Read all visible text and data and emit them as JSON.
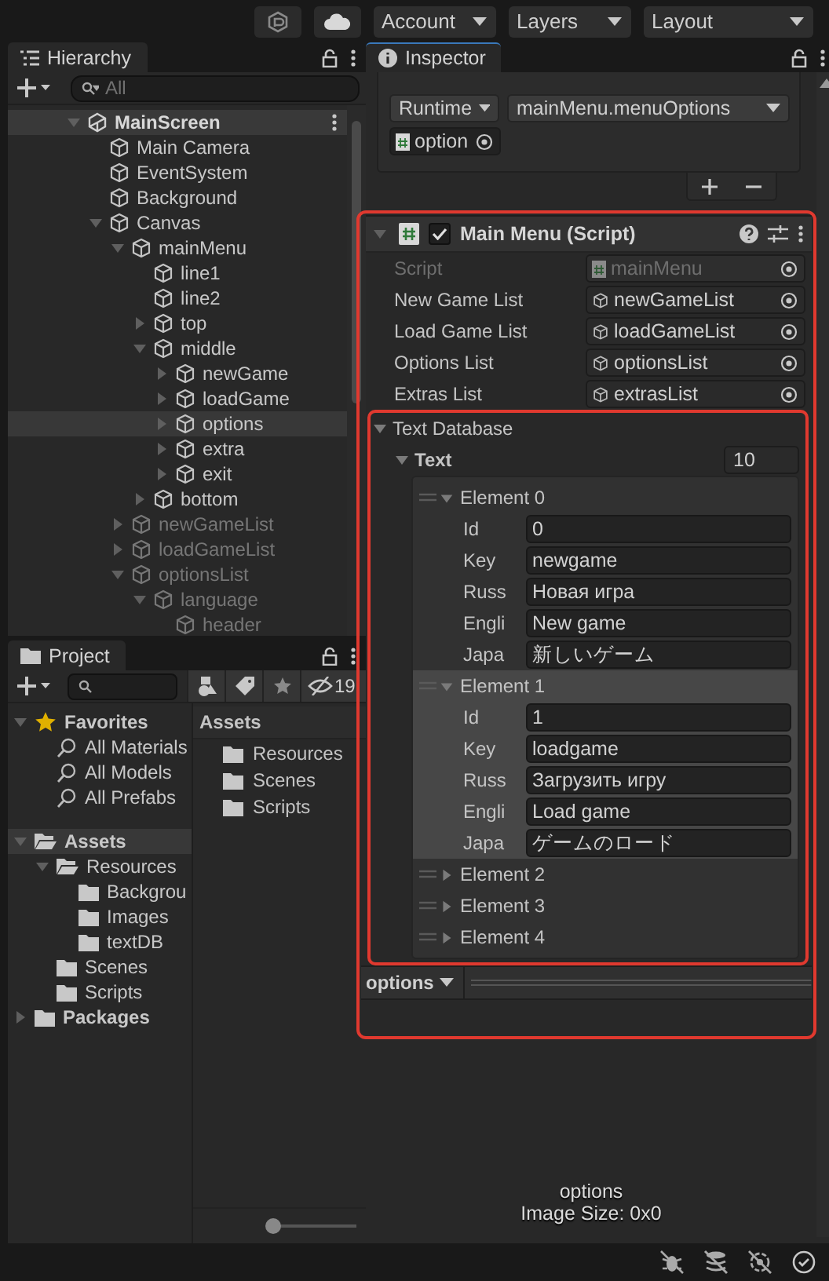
{
  "toolbar": {
    "dropdowns": [
      "Account",
      "Layers",
      "Layout"
    ]
  },
  "hierarchy": {
    "title": "Hierarchy",
    "search": {
      "placeholder": "All"
    },
    "items": [
      {
        "label": "MainScreen",
        "kind": "scene",
        "active": true,
        "selected": false,
        "expanded": true,
        "children": [
          {
            "label": "Main Camera",
            "kind": "object",
            "active": true,
            "selected": false
          },
          {
            "label": "EventSystem",
            "kind": "object",
            "active": true,
            "selected": false
          },
          {
            "label": "Background",
            "kind": "object",
            "active": true,
            "selected": false
          },
          {
            "label": "Canvas",
            "kind": "object",
            "active": true,
            "selected": false,
            "expanded": true,
            "children": [
              {
                "label": "mainMenu",
                "kind": "object",
                "active": true,
                "selected": false,
                "expanded": true,
                "children": [
                  {
                    "label": "line1",
                    "kind": "object",
                    "active": true,
                    "selected": false
                  },
                  {
                    "label": "line2",
                    "kind": "object",
                    "active": true,
                    "selected": false
                  },
                  {
                    "label": "top",
                    "kind": "object",
                    "active": true,
                    "selected": false,
                    "expanded": false
                  },
                  {
                    "label": "middle",
                    "kind": "object",
                    "active": true,
                    "selected": false,
                    "expanded": true,
                    "children": [
                      {
                        "label": "newGame",
                        "kind": "object",
                        "active": true,
                        "selected": false,
                        "expanded": false
                      },
                      {
                        "label": "loadGame",
                        "kind": "object",
                        "active": true,
                        "selected": false,
                        "expanded": false
                      },
                      {
                        "label": "options",
                        "kind": "object",
                        "active": true,
                        "selected": true,
                        "expanded": false
                      },
                      {
                        "label": "extra",
                        "kind": "object",
                        "active": true,
                        "selected": false,
                        "expanded": false
                      },
                      {
                        "label": "exit",
                        "kind": "object",
                        "active": true,
                        "selected": false,
                        "expanded": false
                      }
                    ]
                  },
                  {
                    "label": "bottom",
                    "kind": "object",
                    "active": true,
                    "selected": false,
                    "expanded": false
                  }
                ]
              },
              {
                "label": "newGameList",
                "kind": "object",
                "active": false,
                "selected": false,
                "expanded": false
              },
              {
                "label": "loadGameList",
                "kind": "object",
                "active": false,
                "selected": false,
                "expanded": false
              },
              {
                "label": "optionsList",
                "kind": "object",
                "active": false,
                "selected": false,
                "expanded": true,
                "children": [
                  {
                    "label": "language",
                    "kind": "object",
                    "active": false,
                    "selected": false,
                    "expanded": true,
                    "children": [
                      {
                        "label": "header",
                        "kind": "object",
                        "active": false,
                        "selected": false
                      }
                    ]
                  }
                ]
              }
            ]
          }
        ]
      }
    ]
  },
  "project": {
    "title": "Project",
    "hidden_count": "19",
    "tree": [
      {
        "label": "Favorites",
        "kind": "favorites",
        "selected": false,
        "expanded": true,
        "children": [
          {
            "label": "All Materials",
            "kind": "search",
            "selected": false
          },
          {
            "label": "All Models",
            "kind": "search",
            "selected": false
          },
          {
            "label": "All Prefabs",
            "kind": "search",
            "selected": false
          }
        ]
      },
      {
        "label": "Assets",
        "kind": "folder",
        "selected": true,
        "expanded": true,
        "children": [
          {
            "label": "Resources",
            "kind": "folder",
            "selected": false,
            "expanded": true,
            "children": [
              {
                "label": "Backgrou",
                "kind": "folder",
                "selected": false
              },
              {
                "label": "Images",
                "kind": "folder",
                "selected": false
              },
              {
                "label": "textDB",
                "kind": "folder",
                "selected": false
              }
            ]
          },
          {
            "label": "Scenes",
            "kind": "folder",
            "selected": false
          },
          {
            "label": "Scripts",
            "kind": "folder",
            "selected": false
          }
        ]
      },
      {
        "label": "Packages",
        "kind": "folder",
        "selected": false,
        "expanded": false
      }
    ],
    "folder_title": "Assets",
    "folder_items": [
      "Resources",
      "Scenes",
      "Scripts"
    ],
    "zoom": {
      "level": 0
    }
  },
  "inspector": {
    "title": "Inspector",
    "event": {
      "mode": "Runtime",
      "function": "mainMenu.menuOptions",
      "target": "option"
    },
    "component": {
      "title": "Main Menu (Script)",
      "expanded": true,
      "enabled": true,
      "highlighted": true,
      "fields": [
        {
          "label": "Script",
          "value": "mainMenu",
          "kind": "script",
          "disabled": true
        },
        {
          "label": "New Game List",
          "value": "newGameList",
          "kind": "object",
          "disabled": false
        },
        {
          "label": "Load Game List",
          "value": "loadGameList",
          "kind": "object",
          "disabled": false
        },
        {
          "label": "Options List",
          "value": "optionsList",
          "kind": "object",
          "disabled": false
        },
        {
          "label": "Extras List",
          "value": "extrasList",
          "kind": "object",
          "disabled": false
        }
      ],
      "database": {
        "label": "Text Database",
        "expanded": true,
        "highlighted": true,
        "list_label": "Text",
        "list_expanded": true,
        "size": "10",
        "elements": [
          {
            "label": "Element 0",
            "expanded": true,
            "selected": false,
            "fields": [
              {
                "label": "Id",
                "value": "0"
              },
              {
                "label": "Key",
                "value": "newgame"
              },
              {
                "label": "Russ",
                "value": "Новая игра"
              },
              {
                "label": "Engli",
                "value": "New game"
              },
              {
                "label": "Japa",
                "value": "新しいゲーム"
              }
            ]
          },
          {
            "label": "Element 1",
            "expanded": true,
            "selected": true,
            "fields": [
              {
                "label": "Id",
                "value": "1"
              },
              {
                "label": "Key",
                "value": "loadgame"
              },
              {
                "label": "Russ",
                "value": "Загрузить игру"
              },
              {
                "label": "Engli",
                "value": "Load game"
              },
              {
                "label": "Japa",
                "value": "ゲームのロード"
              }
            ]
          },
          {
            "label": "Element 2",
            "expanded": false,
            "selected": false
          },
          {
            "label": "Element 3",
            "expanded": false,
            "selected": false
          },
          {
            "label": "Element 4",
            "expanded": false,
            "selected": false
          }
        ]
      }
    },
    "preview": {
      "object": "options",
      "name": "options",
      "info": "Image Size: 0x0"
    }
  }
}
